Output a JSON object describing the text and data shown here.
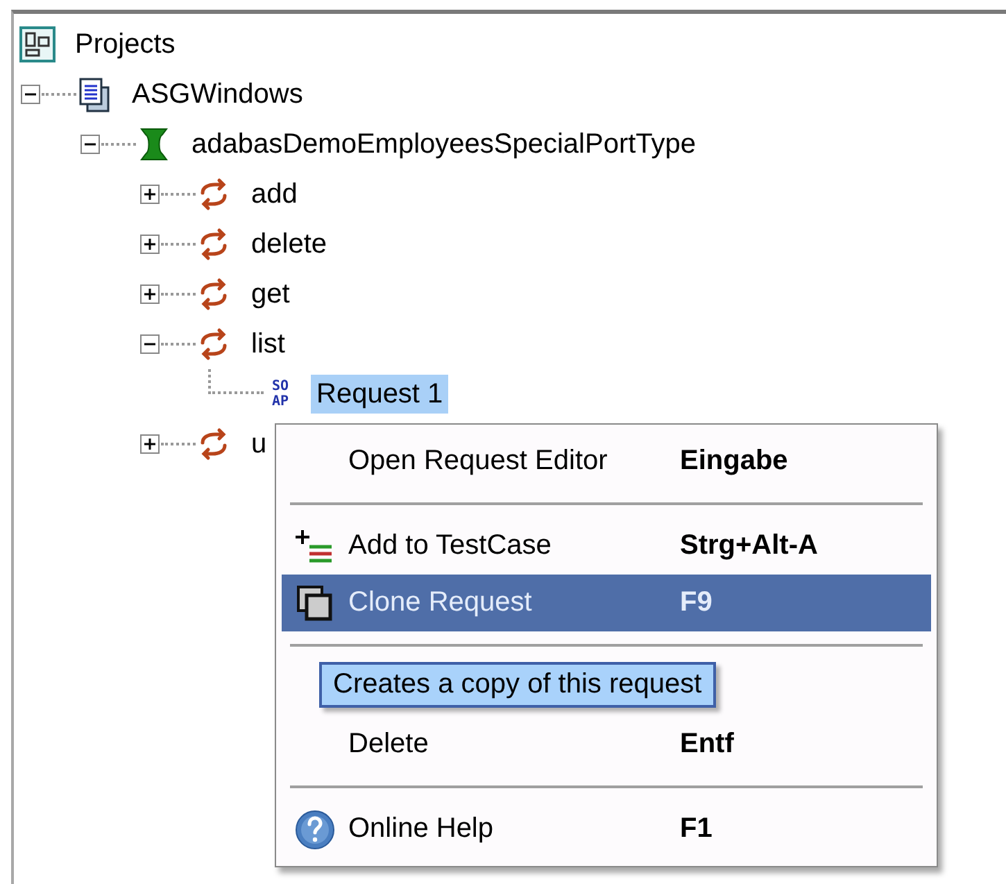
{
  "tree": {
    "label": "Projects",
    "kind": "root",
    "children": [
      {
        "label": "ASGWindows",
        "kind": "project",
        "expanded": true,
        "selected": false,
        "children": [
          {
            "label": "adabasDemoEmployeesSpecialPortType",
            "kind": "interface",
            "expanded": true,
            "selected": false,
            "children": [
              {
                "label": "add",
                "kind": "operation",
                "expanded": false,
                "selected": false
              },
              {
                "label": "delete",
                "kind": "operation",
                "expanded": false,
                "selected": false
              },
              {
                "label": "get",
                "kind": "operation",
                "expanded": false,
                "selected": false
              },
              {
                "label": "list",
                "kind": "operation",
                "expanded": true,
                "selected": false,
                "children": [
                  {
                    "label": "Request 1",
                    "kind": "request",
                    "icon_text": [
                      "SO",
                      "AP"
                    ],
                    "selected": true
                  }
                ]
              },
              {
                "label": "u",
                "kind": "operation",
                "expanded": false,
                "selected": false
              }
            ]
          }
        ]
      }
    ]
  },
  "context_menu": {
    "items": [
      {
        "kind": "plain",
        "label": "Open Request Editor",
        "shortcut": "Eingabe",
        "selected": false
      },
      {
        "kind": "separator"
      },
      {
        "kind": "add",
        "label": "Add to TestCase",
        "shortcut": "Strg+Alt-A",
        "selected": false
      },
      {
        "kind": "clone",
        "label": "Clone Request",
        "shortcut": "F9",
        "selected": true
      },
      {
        "kind": "separator"
      },
      {
        "kind": "covered"
      },
      {
        "kind": "plain",
        "label": "Delete",
        "shortcut": "Entf",
        "selected": false
      },
      {
        "kind": "separator"
      },
      {
        "kind": "help",
        "label": "Online Help",
        "shortcut": "F1",
        "selected": false
      }
    ],
    "tooltip": "Creates a copy of this request"
  }
}
